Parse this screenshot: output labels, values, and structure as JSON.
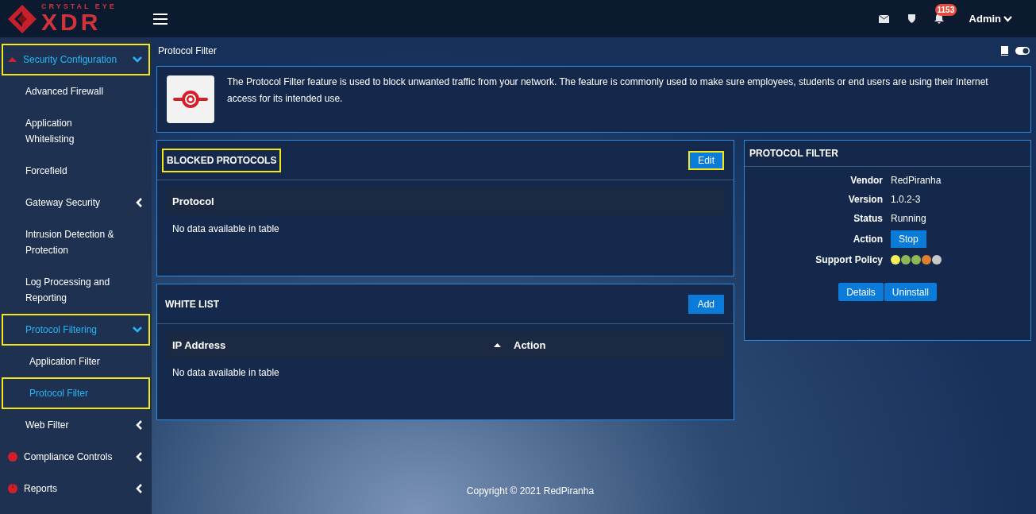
{
  "brand": {
    "tagline": "CRYSTAL EYE",
    "name": "XDR"
  },
  "topbar": {
    "notification_count": "1153",
    "user": "Admin"
  },
  "sidebar": {
    "items": [
      {
        "label": "Security Configuration",
        "kind": "group",
        "expanded": true,
        "highlighted": true,
        "children": [
          {
            "label": "Advanced Firewall",
            "kind": "link",
            "selected": false,
            "highlighted": false
          },
          {
            "label": "Application Whitelisting",
            "kind": "link",
            "selected": false,
            "highlighted": false
          },
          {
            "label": "Forcefield",
            "kind": "link",
            "selected": false,
            "highlighted": false
          },
          {
            "label": "Gateway Security",
            "kind": "group",
            "expanded": false,
            "highlighted": false
          },
          {
            "label": "Intrusion Detection & Protection",
            "kind": "link",
            "selected": false,
            "highlighted": false
          },
          {
            "label": "Log Processing and Reporting",
            "kind": "link",
            "selected": false,
            "highlighted": false
          },
          {
            "label": "Protocol Filtering",
            "kind": "group",
            "expanded": true,
            "highlighted": true,
            "children": [
              {
                "label": "Application Filter",
                "selected": false,
                "highlighted": false
              },
              {
                "label": "Protocol Filter",
                "selected": true,
                "highlighted": true
              }
            ]
          },
          {
            "label": "Web Filter",
            "kind": "group",
            "expanded": false,
            "highlighted": false
          }
        ]
      },
      {
        "label": "Compliance Controls",
        "kind": "group",
        "expanded": false,
        "highlighted": false
      },
      {
        "label": "Reports",
        "kind": "group",
        "expanded": false,
        "highlighted": false
      }
    ]
  },
  "page_title": "Protocol Filter",
  "info": "The Protocol Filter feature is used to block unwanted traffic from your network. The feature is commonly used to make sure employees, students or end users are using their Internet access for its intended use.",
  "panels": [
    {
      "title": "BLOCKED PROTOCOLS",
      "highlighted": true,
      "button": {
        "label": "Edit",
        "highlighted": true
      },
      "columns": [
        {
          "label": "Protocol",
          "sorted": false
        }
      ],
      "empty": "No data available in table"
    },
    {
      "title": "WHITE LIST",
      "highlighted": false,
      "button": {
        "label": "Add",
        "highlighted": false
      },
      "columns": [
        {
          "label": "IP Address",
          "sorted": true
        },
        {
          "label": "Action",
          "sorted": false
        }
      ],
      "empty": "No data available in table"
    }
  ],
  "details": {
    "title": "PROTOCOL FILTER",
    "fields": [
      {
        "label": "Vendor",
        "kind": "text",
        "value": "RedPiranha"
      },
      {
        "label": "Version",
        "kind": "text",
        "value": "1.0.2-3"
      },
      {
        "label": "Status",
        "kind": "text",
        "value": "Running"
      },
      {
        "label": "Action",
        "kind": "button",
        "value": "Stop"
      },
      {
        "label": "Support Policy",
        "kind": "dots",
        "dots": [
          {
            "color": "#f3f05a"
          },
          {
            "color": "#8fb753"
          },
          {
            "color": "#8fb753"
          },
          {
            "color": "#e0802f"
          },
          {
            "color": "#c8c8c8"
          }
        ]
      }
    ],
    "buttons": [
      "Details",
      "Uninstall"
    ]
  },
  "footer": "Copyright © 2021 RedPiranha"
}
